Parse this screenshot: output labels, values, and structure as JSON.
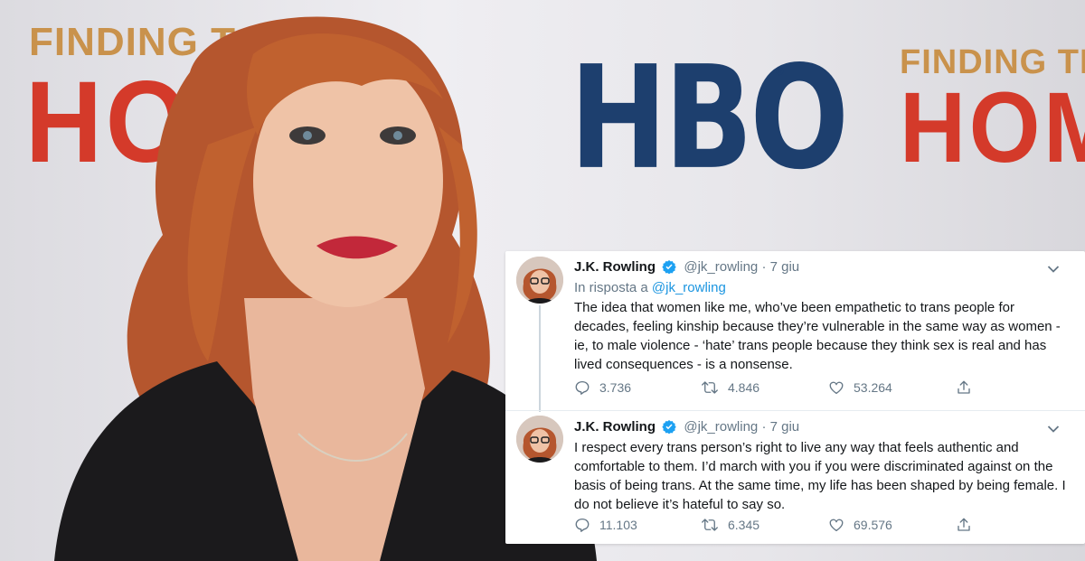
{
  "background": {
    "banner_left_top": "FINDING T",
    "banner_left_big": "HO",
    "banner_center": "HBO",
    "banner_center_mark": "®",
    "banner_right_top": "FINDING THE",
    "banner_right_big": "HOM"
  },
  "tweets": [
    {
      "author_name": "J.K. Rowling",
      "handle": "@jk_rowling",
      "separator": "·",
      "date": "7 giu",
      "reply_prefix": "In risposta a",
      "reply_handle": "@jk_rowling",
      "text": "The idea that women like me, who’ve been empathetic to trans people for decades, feeling kinship because they’re vulnerable in the same way as women - ie, to male violence - ‘hate’ trans people because they think sex is real and has lived consequences - is a nonsense.",
      "replies": "3.736",
      "retweets": "4.846",
      "likes": "53.264"
    },
    {
      "author_name": "J.K. Rowling",
      "handle": "@jk_rowling",
      "separator": "·",
      "date": "7 giu",
      "text": "I respect every trans person’s right to live any way that feels authentic and comfortable to them. I’d march with you if you were discriminated against on the basis of being trans. At the same time, my life has been shaped by being female. I do not believe it’s hateful to say so.",
      "replies": "11.103",
      "retweets": "6.345",
      "likes": "69.576"
    }
  ],
  "colors": {
    "accent": "#1b95e0",
    "muted": "#657786",
    "text": "#14171a",
    "verified": "#1da1f2"
  },
  "icons": [
    "verified-badge-icon",
    "chevron-down-icon",
    "reply-icon",
    "retweet-icon",
    "like-heart-icon",
    "share-icon"
  ]
}
